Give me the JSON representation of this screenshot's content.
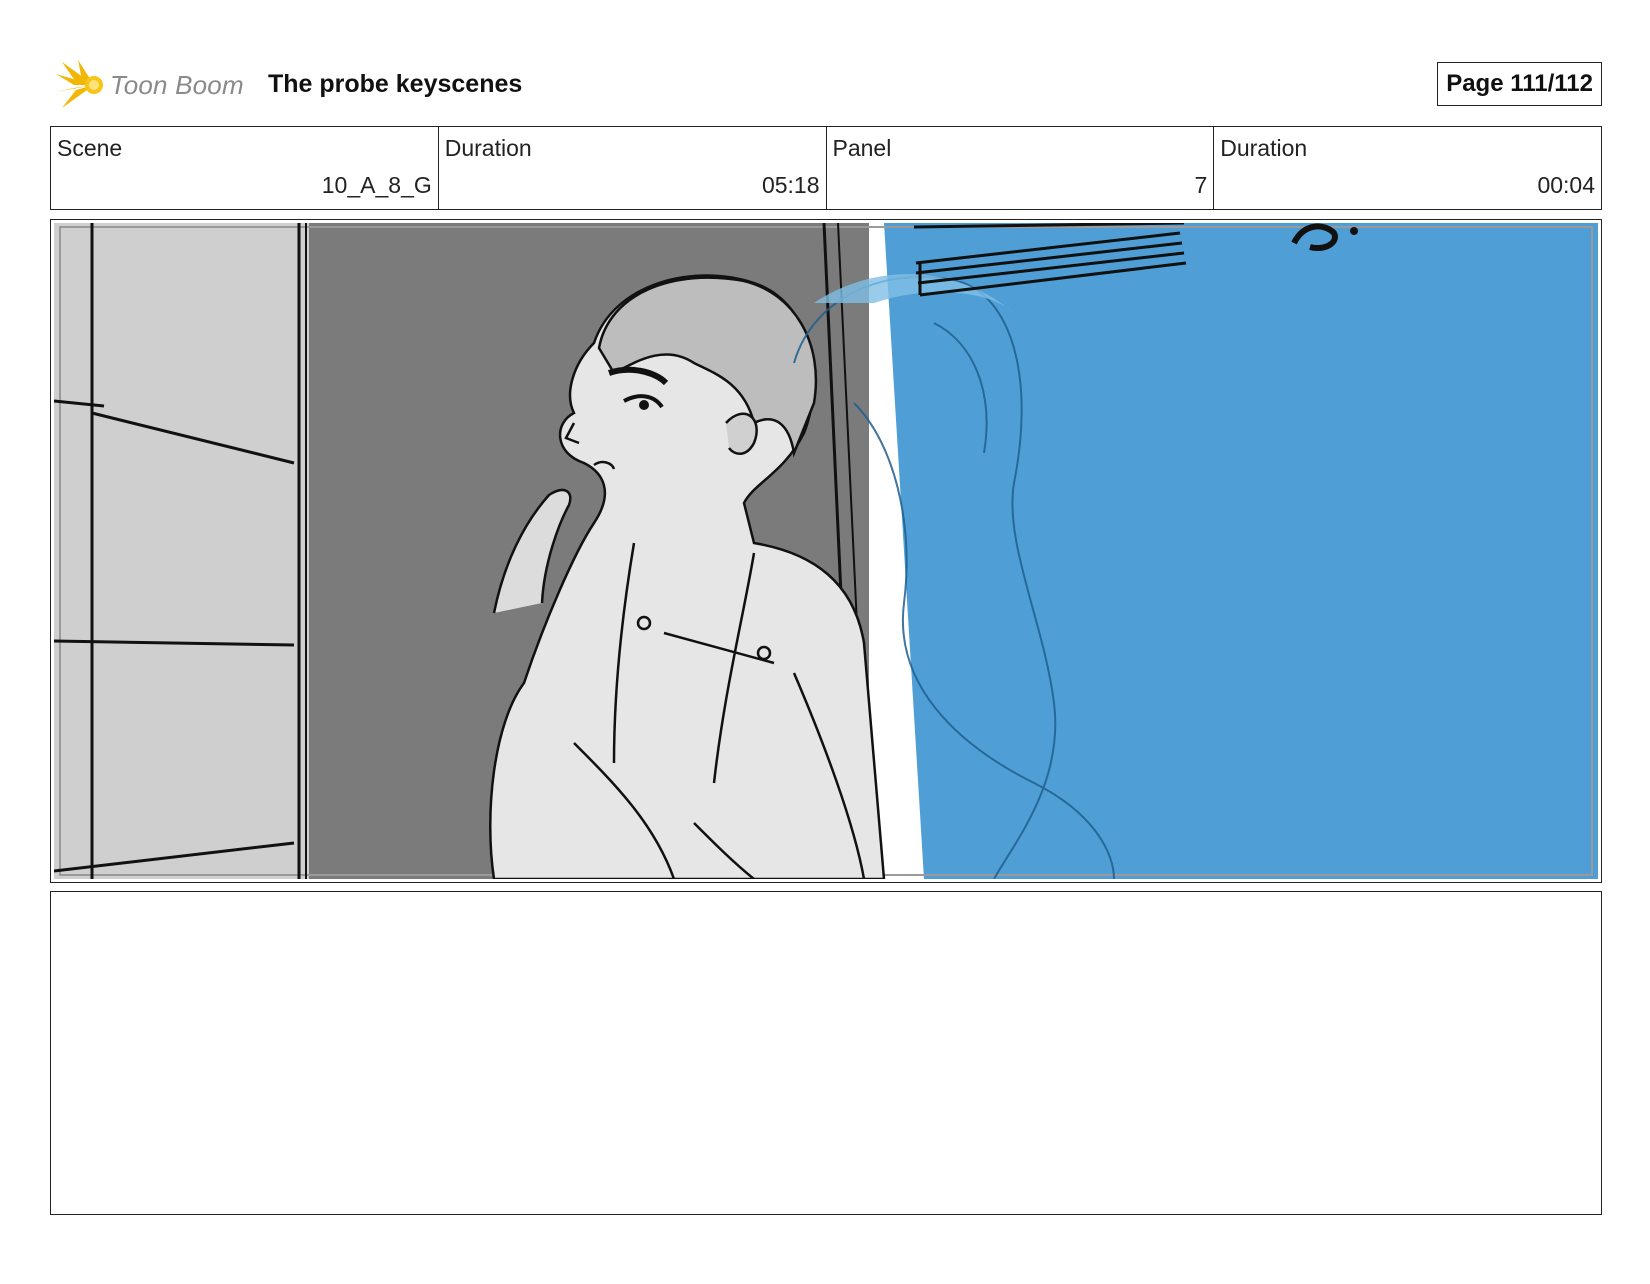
{
  "header": {
    "logo_text": "Toon Boom",
    "project_title": "The probe keyscenes",
    "page_label": "Page 111/112"
  },
  "info": {
    "scene_label": "Scene",
    "scene_value": "10_A_8_G",
    "scene_duration_label": "Duration",
    "scene_duration_value": "05:18",
    "panel_label": "Panel",
    "panel_value": "7",
    "panel_duration_label": "Duration",
    "panel_duration_value": "00:04"
  },
  "notes": {
    "text": ""
  },
  "colors": {
    "wall_light": "#cfcfcf",
    "wall_dark": "#7a7a7a",
    "skin_light": "#e9e9e9",
    "foreground_blue": "#4f9fd6",
    "logo_yellow": "#f2b705"
  },
  "icons": {
    "logo": "toon-boom-sunburst-icon"
  }
}
